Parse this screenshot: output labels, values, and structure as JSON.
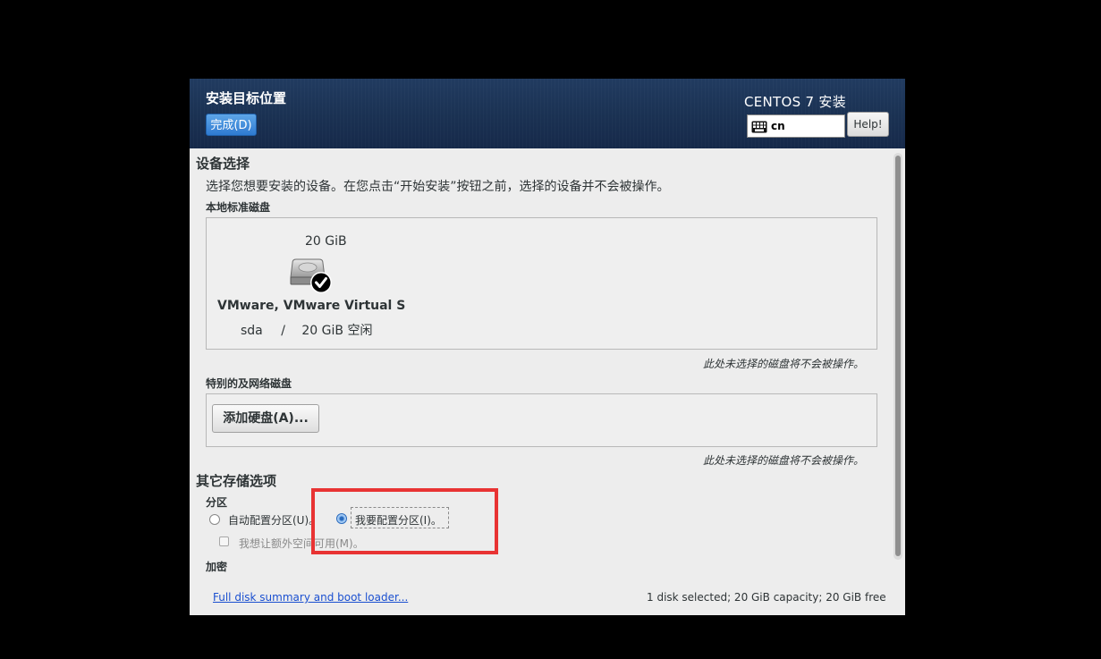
{
  "header": {
    "title": "安装目标位置",
    "done_label": "完成(D)",
    "product": "CENTOS 7 安装",
    "keyboard_layout": "cn",
    "help_label": "Help!"
  },
  "device_selection": {
    "heading": "设备选择",
    "description": "选择您想要安装的设备。在您点击“开始安装”按钮之前，选择的设备并不会被操作。",
    "local_disks_label": "本地标准磁盘",
    "disk": {
      "size": "20 GiB",
      "name": "VMware, VMware Virtual S",
      "device": "sda",
      "separator": "/",
      "free": "20 GiB 空闲",
      "selected": true
    },
    "local_note": "此处未选择的磁盘将不会被操作。",
    "network_disks_label": "特别的及网络磁盘",
    "add_disk_label": "添加硬盘(A)...",
    "network_note": "此处未选择的磁盘将不会被操作。"
  },
  "other_storage": {
    "heading": "其它存储选项",
    "partition_label": "分区",
    "auto_partition_label": "自动配置分区(U)。",
    "manual_partition_label": "我要配置分区(I)。",
    "manual_selected": true,
    "extra_space_label": "我想让额外空间可用(M)。",
    "encryption_label": "加密"
  },
  "footer": {
    "link_label": "Full disk summary and boot loader...",
    "summary": "1 disk selected; 20 GiB capacity; 20 GiB free"
  },
  "colors": {
    "header_bg": "#1a3152",
    "accent": "#2e7ad1",
    "annotation": "#e83333"
  }
}
